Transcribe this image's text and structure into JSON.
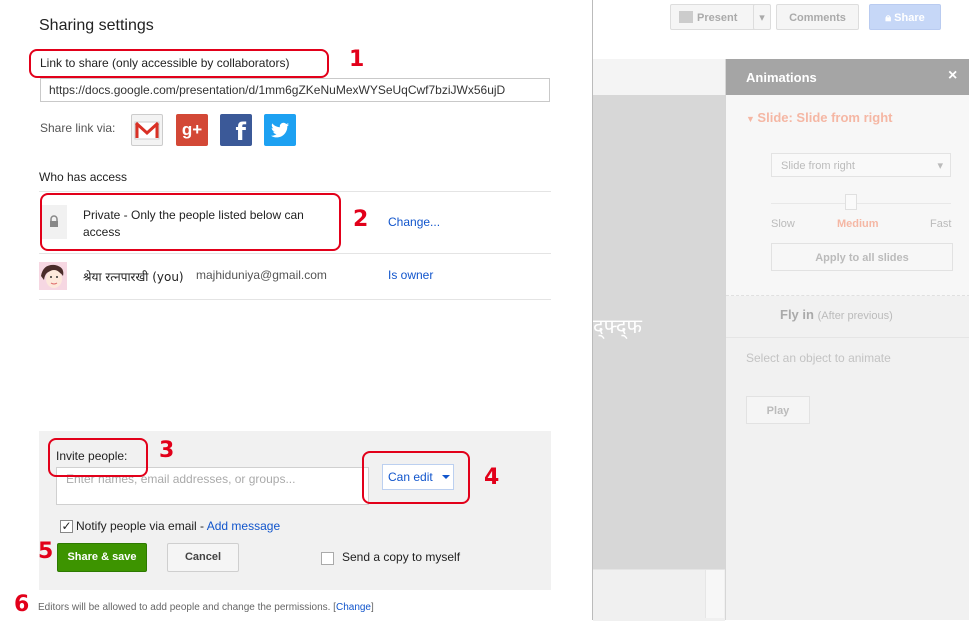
{
  "background": {
    "toolbar": {
      "present_label": "Present",
      "comments_label": "Comments",
      "share_label": "Share"
    },
    "slide_text": "द्फ्द्फ",
    "animations_panel": {
      "title": "Animations",
      "close": "×",
      "selected_animation": "Slide: Slide from right",
      "dropdown_value": "Slide from right",
      "speed_slow": "Slow",
      "speed_medium": "Medium",
      "speed_fast": "Fast",
      "apply_all_label": "Apply to all slides",
      "fly_in_label": "Fly in",
      "fly_in_sub": "(After previous)",
      "select_object_text": "Select an object to animate",
      "play_label": "Play"
    }
  },
  "dialog": {
    "title": "Sharing settings",
    "link_label": "Link to share (only accessible by collaborators)",
    "link_value": "https://docs.google.com/presentation/d/1mm6gZKeNuMexWYSeUqCwf7bziJWx56ujD",
    "share_via_label": "Share link via:",
    "share_icons": [
      "gmail-icon",
      "google-plus-icon",
      "facebook-icon",
      "twitter-icon"
    ],
    "gplus_glyph": "g+",
    "fb_glyph": "f",
    "who_has_access_label": "Who has access",
    "access": {
      "text": "Private - Only the people listed below can access",
      "change_link": "Change..."
    },
    "owner": {
      "name": "श्रेया रत्नपारखी (you)",
      "email": "majhiduniya@gmail.com",
      "role": "Is owner"
    },
    "invite": {
      "label": "Invite people:",
      "placeholder": "Enter names, email addresses, or groups...",
      "permission": "Can edit",
      "notify_checked": true,
      "notify_label": "Notify people via email - ",
      "add_message": "Add message",
      "share_save_label": "Share & save",
      "cancel_label": "Cancel",
      "copy_label": "Send a copy to myself",
      "copy_checked": false
    },
    "footer_note": "Editors will be allowed to add people and change the permissions.",
    "footer_change": "Change"
  },
  "annotations": {
    "n1": "1",
    "n2": "2",
    "n3": "3",
    "n4": "4",
    "n5": "5",
    "n6": "6",
    "color": "#e2001a"
  }
}
